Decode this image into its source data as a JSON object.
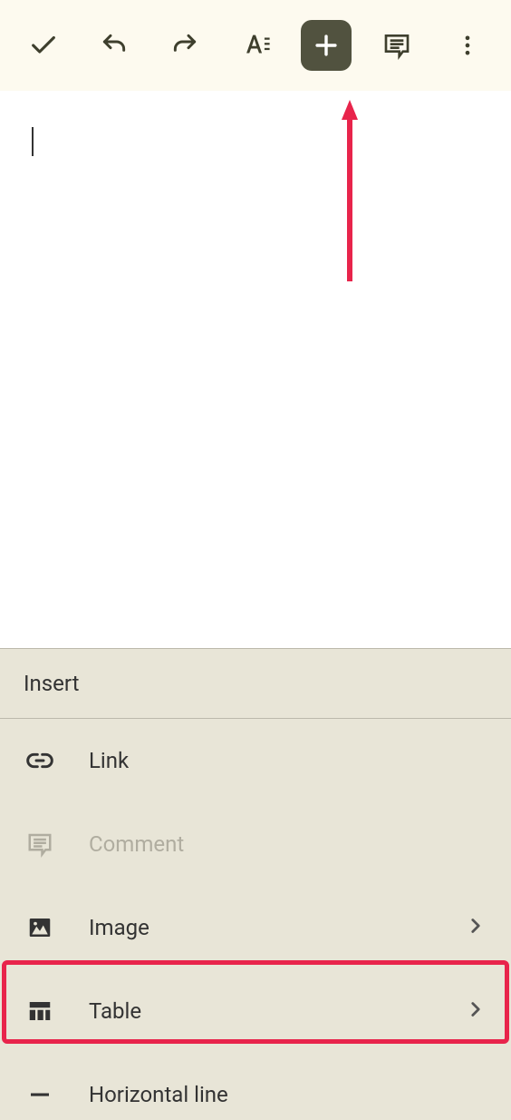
{
  "insertPanel": {
    "title": "Insert",
    "items": [
      {
        "label": "Link",
        "icon": "link",
        "hasChevron": false,
        "disabled": false
      },
      {
        "label": "Comment",
        "icon": "comment",
        "hasChevron": false,
        "disabled": true
      },
      {
        "label": "Image",
        "icon": "image",
        "hasChevron": true,
        "disabled": false
      },
      {
        "label": "Table",
        "icon": "table",
        "hasChevron": true,
        "disabled": false
      },
      {
        "label": "Horizontal line",
        "icon": "hr",
        "hasChevron": false,
        "disabled": false
      }
    ]
  }
}
